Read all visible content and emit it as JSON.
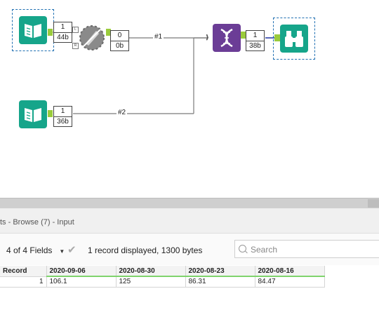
{
  "canvas": {
    "tools": [
      {
        "id": "input-1",
        "icon": "book-icon",
        "color": "#16a58a",
        "selected": true
      },
      {
        "id": "join",
        "icon": "join-icon-disabled",
        "color": "#8a8a8a"
      },
      {
        "id": "input-2",
        "icon": "book-icon",
        "color": "#16a58a"
      },
      {
        "id": "transpose",
        "icon": "dna-icon",
        "color": "#6b3d96"
      },
      {
        "id": "browse",
        "icon": "binoculars-icon",
        "color": "#16a58a",
        "selected": true
      }
    ],
    "badges": {
      "input1": {
        "count": "1",
        "size": "44b"
      },
      "join": {
        "count": "0",
        "size": "0b"
      },
      "input2": {
        "count": "1",
        "size": "36b"
      },
      "transpose": {
        "count": "1",
        "size": "38b"
      }
    },
    "anchor_labels": {
      "left": "L",
      "right": "R"
    },
    "wire_labels": {
      "w1": "#1",
      "w2": "#2"
    }
  },
  "results": {
    "title": "ts - Browse (7) - Input",
    "fields_label": "4 of 4 Fields",
    "records_text": "1 record displayed, 1300 bytes",
    "search_placeholder": "Search",
    "columns": [
      "Record",
      "2020-09-06",
      "2020-08-30",
      "2020-08-23",
      "2020-08-16"
    ],
    "rows": [
      [
        "1",
        "106.1",
        "125",
        "86.31",
        "84.47"
      ]
    ]
  },
  "colors": {
    "tool_teal": "#16a58a",
    "tool_purple": "#6b3d96",
    "anchor_green": "#9acb3c",
    "header_underline": "#7fd36d",
    "selection": "#1f6fb2"
  }
}
